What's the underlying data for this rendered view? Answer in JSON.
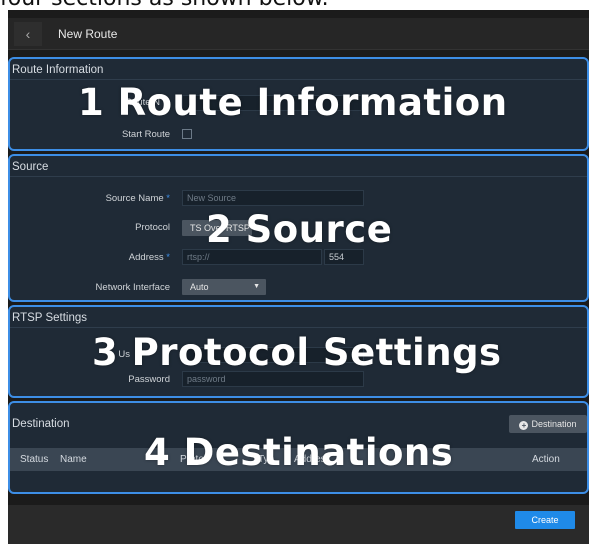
{
  "caption": "four sections as shown below.",
  "header": {
    "back_icon": "chevron-left-icon",
    "title": "New Route"
  },
  "route_info": {
    "title": "Route Information",
    "route_name_label": "Route N",
    "start_route_label": "Start Route",
    "overlay": "1 Route Information"
  },
  "source": {
    "title": "Source",
    "source_name_label": "Source Name",
    "source_name_placeholder": "New Source",
    "protocol_label": "Protocol",
    "protocol_value": "TS Over RTSP",
    "address_label": "Address",
    "address_placeholder": "rtsp://",
    "port_value": "554",
    "network_interface_label": "Network Interface",
    "network_interface_value": "Auto",
    "required_marker": "*",
    "overlay": "2 Source"
  },
  "rtsp": {
    "title": "RTSP Settings",
    "username_label": "Us",
    "password_label": "Password",
    "password_placeholder": "password",
    "overlay": "3 Protocol Settings"
  },
  "destination": {
    "title": "Destination",
    "add_button_label": "Destination",
    "add_icon": "plus-circle-icon",
    "columns": [
      "Status",
      "Name",
      "Protoc",
      "Typ",
      "Addres",
      "Action"
    ],
    "overlay": "4 Destinations"
  },
  "footer": {
    "create_label": "Create"
  },
  "colors": {
    "accent": "#3d8ee6",
    "primary_button": "#1f8ae8",
    "panel_bg": "#1f2a36"
  }
}
